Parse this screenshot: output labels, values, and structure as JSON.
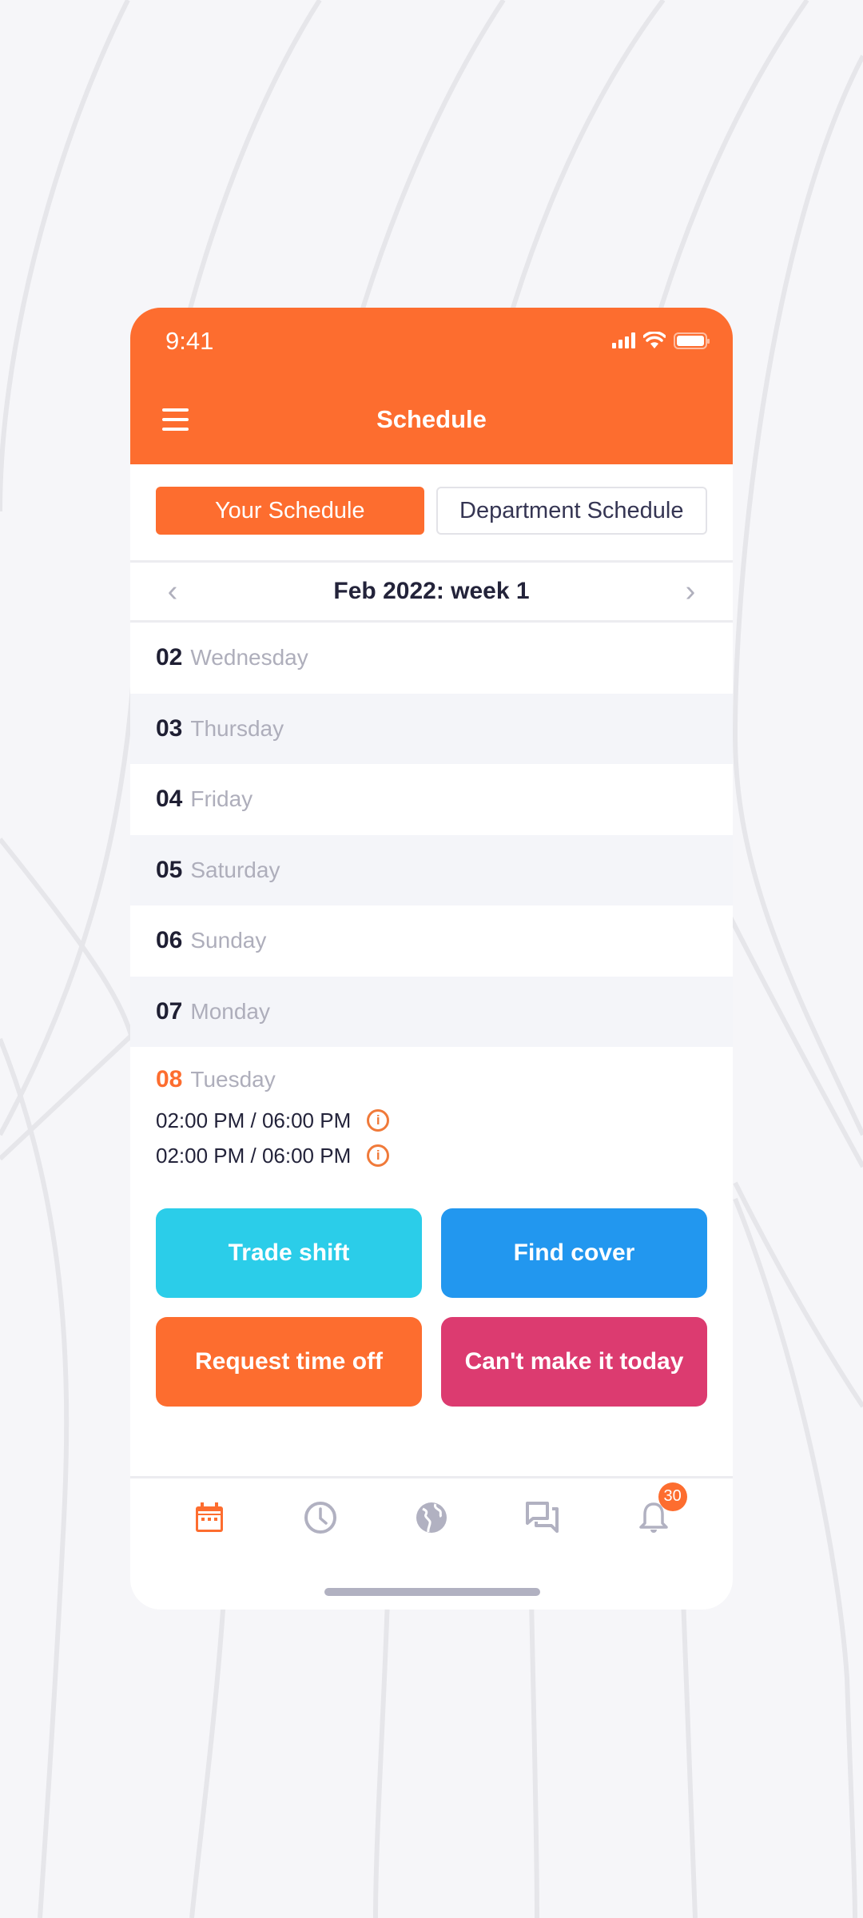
{
  "status_bar": {
    "time": "9:41"
  },
  "header": {
    "title": "Schedule",
    "menu_icon": "hamburger-icon"
  },
  "segment": {
    "options": [
      {
        "label": "Your Schedule",
        "active": true
      },
      {
        "label": "Department Schedule",
        "active": false
      }
    ]
  },
  "week_nav": {
    "label": "Feb 2022: week 1",
    "prev_icon": "chevron-left-icon",
    "next_icon": "chevron-right-icon"
  },
  "days": [
    {
      "num": "02",
      "name": "Wednesday"
    },
    {
      "num": "03",
      "name": "Thursday"
    },
    {
      "num": "04",
      "name": "Friday"
    },
    {
      "num": "05",
      "name": "Saturday"
    },
    {
      "num": "06",
      "name": "Sunday"
    },
    {
      "num": "07",
      "name": "Monday"
    }
  ],
  "today": {
    "num": "08",
    "name": "Tuesday",
    "shifts": [
      "02:00 PM / 06:00 PM",
      "02:00 PM / 06:00 PM"
    ],
    "info_glyph": "i"
  },
  "actions": [
    {
      "label": "Trade shift",
      "color": "#2bcde9"
    },
    {
      "label": "Find cover",
      "color": "#2297ef"
    },
    {
      "label": "Request time off",
      "color": "#fd6d2f"
    },
    {
      "label": "Can't make it today",
      "color": "#dc3b70"
    }
  ],
  "tabbar": {
    "items": [
      "calendar-icon",
      "clock-icon",
      "globe-icon",
      "chat-icon",
      "bell-icon"
    ],
    "active_index": 0,
    "notification_count": "30"
  },
  "colors": {
    "accent": "#fd6d2f",
    "inactive_icon": "#b1b1c1"
  }
}
